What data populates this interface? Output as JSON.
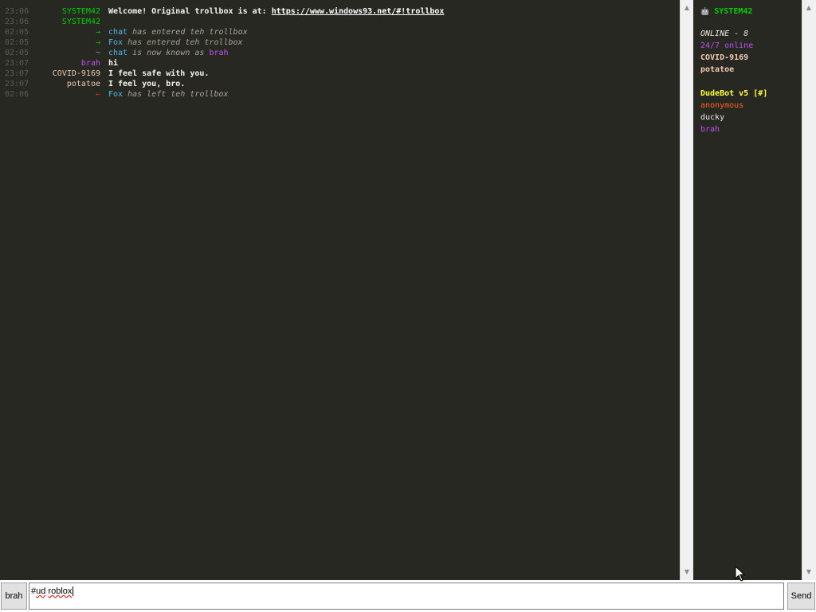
{
  "chat": {
    "messages": [
      {
        "time": "23:06",
        "nick": "SYSTEM42",
        "nick_color": "#00d000",
        "text": "Welcome! Original trollbox is at:",
        "link": "https://www.windows93.net/#!trollbox",
        "type": "bold"
      },
      {
        "time": "23:06",
        "nick": "SYSTEM42",
        "nick_color": "#00d000",
        "text": "",
        "type": "bold"
      },
      {
        "time": "02:05",
        "nick": "→",
        "nick_color": "#00d000",
        "subject": "chat",
        "subject_color": "#4cb8e8",
        "text": "has entered teh trollbox",
        "type": "event"
      },
      {
        "time": "02:05",
        "nick": "→",
        "nick_color": "#00d000",
        "subject": "Fox",
        "subject_color": "#4cb8e8",
        "text": "has entered teh trollbox",
        "type": "event"
      },
      {
        "time": "02:05",
        "nick": "~",
        "nick_color": "#a6a39a",
        "subject": "chat",
        "subject_color": "#4cb8e8",
        "text": "is now known as",
        "object": "brah",
        "object_color": "#c050f0",
        "type": "event"
      },
      {
        "time": "23:07",
        "nick": "brah",
        "nick_color": "#c050f0",
        "text": "hi",
        "type": "bold"
      },
      {
        "time": "23:07",
        "nick": "COVID-9169",
        "nick_color": "#f0c8b4",
        "text": "I feel safe with you.",
        "type": "bold"
      },
      {
        "time": "23:07",
        "nick": "potatoe",
        "nick_color": "#f0c8b4",
        "text": "I feel you, bro.",
        "type": "bold"
      },
      {
        "time": "02:06",
        "nick": "←",
        "nick_color": "#e02020",
        "subject": "Fox",
        "subject_color": "#4cb8e8",
        "text": "has left teh trollbox",
        "type": "event"
      }
    ]
  },
  "users": {
    "header": {
      "icon": "robot-icon",
      "name": "SYSTEM42",
      "color": "#00d000"
    },
    "online_label": "ONLINE - 8",
    "list": [
      {
        "name": "24/7 online",
        "color": "#c050f0"
      },
      {
        "name": "COVID-9169",
        "color": "#f0c8b4"
      },
      {
        "name": "potatoe",
        "color": "#f0c8b4"
      },
      {
        "name": "DudeBot v5 [#]",
        "color": "#ffff40"
      },
      {
        "name": "anonymous",
        "color": "#ff6020"
      },
      {
        "name": "ducky",
        "color": "#e8e8e0"
      },
      {
        "name": "brah",
        "color": "#c050f0"
      }
    ]
  },
  "bottom": {
    "nick_button": "brah",
    "input_value_prefix": "#",
    "input_value_word1": "ud",
    "input_value_word2": "roblox",
    "send_button": "Send"
  },
  "colors": {
    "background": "#272822",
    "scrollbar": "#f0f0f0"
  }
}
